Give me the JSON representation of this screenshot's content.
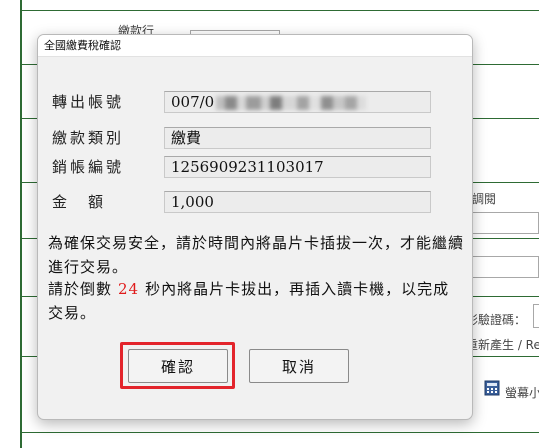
{
  "background": {
    "labels": [
      "繳款行",
      "調閱",
      "影驗證碼：",
      "重新產生 / Re",
      "螢幕小"
    ],
    "icons": [
      "calculator-icon"
    ]
  },
  "dialog": {
    "title": "全國繳費稅確認",
    "fields": [
      {
        "label": "轉出帳號",
        "value": "007/0"
      },
      {
        "label": "繳款類別",
        "value": "繳費"
      },
      {
        "label": "銷帳編號",
        "value": "1256909231103017"
      },
      {
        "label": "金　額",
        "value": "1,000"
      }
    ],
    "message1": "為確保交易安全，請於時間內將晶片卡插拔一次，才能繼續進行交易。",
    "message2_prefix": "請於倒數",
    "countdown": "24",
    "message2_suffix": "秒內將晶片卡拔出，再插入讀卡機，以完成交易。",
    "confirm_label": "確認",
    "cancel_label": "取消"
  },
  "colors": {
    "accent_red": "#e3242b",
    "countdown": "#e01b1b",
    "page_lines": "#2e6b34"
  }
}
